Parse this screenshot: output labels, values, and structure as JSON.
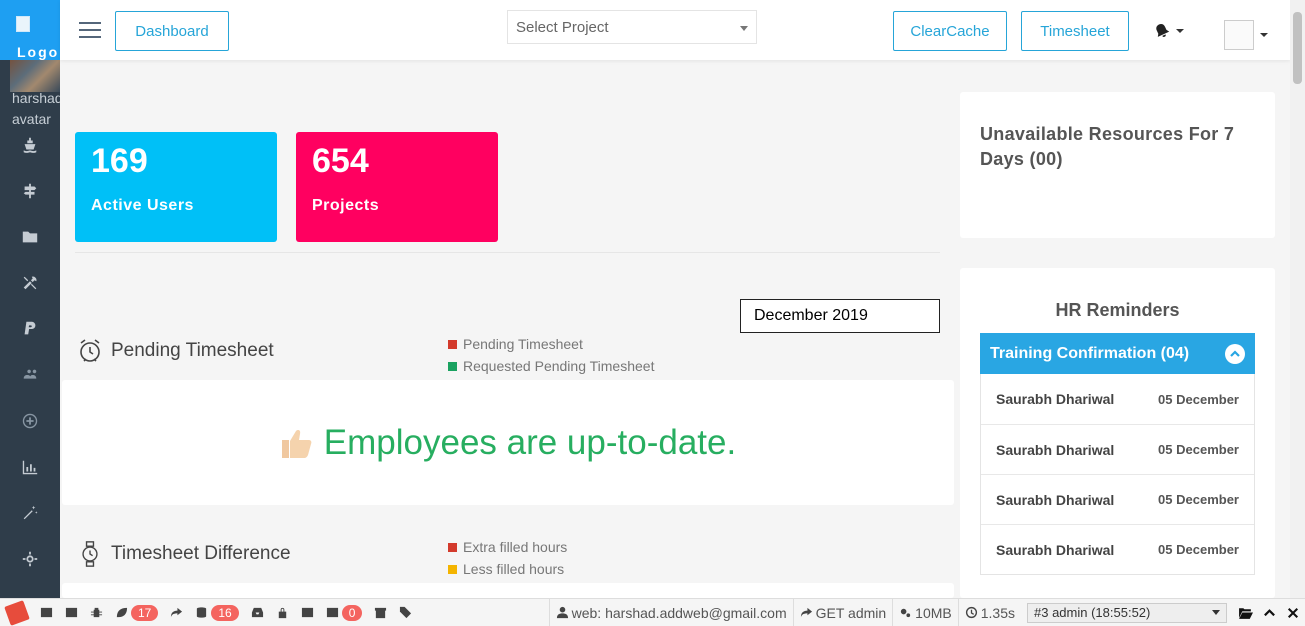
{
  "sidebar": {
    "logo_alt": "Logo",
    "avatar_alt": "harshad avatar",
    "icons": [
      "ship-icon",
      "signpost-icon",
      "folder-icon",
      "tools-icon",
      "paypal-icon",
      "users-icon",
      "plus-circle-icon",
      "bar-chart-icon",
      "magic-wand-icon",
      "settings-icon",
      "screen-icon"
    ]
  },
  "topbar": {
    "dashboard_label": "Dashboard",
    "select_project_placeholder": "Select Project",
    "clearcache_label": "ClearCache",
    "timesheet_label": "Timesheet"
  },
  "stats": [
    {
      "value": "169",
      "label": "Active Users",
      "color": "#00c0f7"
    },
    {
      "value": "654",
      "label": "Projects",
      "color": "#ff0060"
    }
  ],
  "month_input": "December 2019",
  "pending": {
    "title": "Pending Timesheet",
    "legend": [
      {
        "label": "Pending Timesheet",
        "color": "#d33a2c"
      },
      {
        "label": "Requested Pending Timesheet",
        "color": "#1aa260"
      }
    ],
    "message": "Employees are up-to-date."
  },
  "difference": {
    "title": "Timesheet Difference",
    "legend": [
      {
        "label": "Extra filled hours",
        "color": "#d33a2c"
      },
      {
        "label": "Less filled hours",
        "color": "#f4b400"
      }
    ]
  },
  "unavailable": {
    "title": "Unavailable Resources For 7 Days (00)"
  },
  "hr": {
    "title": "HR Reminders",
    "accordion_title": "Training Confirmation (04)",
    "rows": [
      {
        "name": "Saurabh Dhariwal",
        "date": "05 December"
      },
      {
        "name": "Saurabh Dhariwal",
        "date": "05 December"
      },
      {
        "name": "Saurabh Dhariwal",
        "date": "05 December"
      },
      {
        "name": "Saurabh Dhariwal",
        "date": "05 December"
      }
    ]
  },
  "debugbar": {
    "badges": [
      "17",
      "16",
      "0"
    ],
    "user": "web: harshad.addweb@gmail.com",
    "route": "GET admin",
    "memory": "10MB",
    "time": "1.35s",
    "request": "#3 admin (18:55:52)"
  }
}
